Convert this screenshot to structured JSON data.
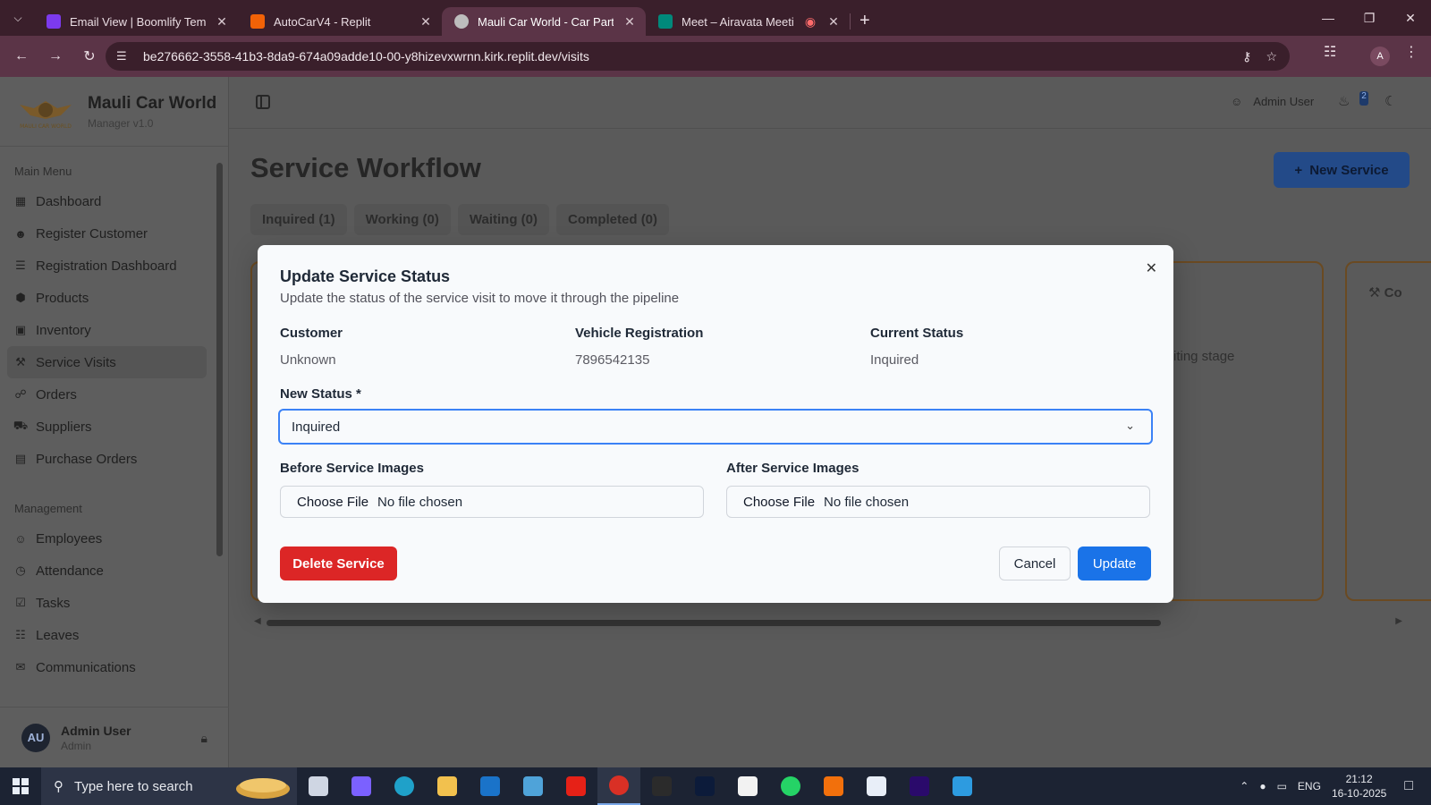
{
  "browser": {
    "tabs": [
      {
        "title": "Email View | Boomlify Temporary",
        "color": "#7c3aed"
      },
      {
        "title": "AutoCarV4 - Replit",
        "color": "#f26207"
      },
      {
        "title": "Mauli Car World - Car Parts & Se",
        "color": "#bdbdbd"
      },
      {
        "title": "Meet – Airavata Meeting",
        "color": "#00897b"
      }
    ],
    "url": "be276662-3558-41b3-8da9-674a09adde10-00-y8hizevxwrnn.kirk.replit.dev/visits",
    "profile_initial": "A"
  },
  "app": {
    "brand_name": "Mauli Car World",
    "brand_version": "Manager v1.0",
    "logo_text": "MAULI CAR WORLD",
    "sections": [
      {
        "title": "Main Menu",
        "items": [
          {
            "label": "Dashboard",
            "icon": "grid-icon"
          },
          {
            "label": "Register Customer",
            "icon": "user-plus-icon"
          },
          {
            "label": "Registration Dashboard",
            "icon": "list-icon"
          },
          {
            "label": "Products",
            "icon": "box-icon"
          },
          {
            "label": "Inventory",
            "icon": "layers-icon"
          },
          {
            "label": "Service Visits",
            "icon": "wrench-icon"
          },
          {
            "label": "Orders",
            "icon": "cart-icon"
          },
          {
            "label": "Suppliers",
            "icon": "truck-icon"
          },
          {
            "label": "Purchase Orders",
            "icon": "file-icon"
          }
        ]
      },
      {
        "title": "Management",
        "items": [
          {
            "label": "Employees",
            "icon": "users-icon"
          },
          {
            "label": "Attendance",
            "icon": "clock-icon"
          },
          {
            "label": "Tasks",
            "icon": "check-square-icon"
          },
          {
            "label": "Leaves",
            "icon": "calendar-icon"
          },
          {
            "label": "Communications",
            "icon": "message-icon"
          }
        ]
      }
    ],
    "user": {
      "initials": "AU",
      "name": "Admin User",
      "role": "Admin"
    },
    "header_user": "Admin User",
    "notification_count": "2",
    "page_title": "Service Workflow",
    "new_service_label": "New Service",
    "workflow_tabs": [
      "Inquired (1)",
      "Working (0)",
      "Waiting (0)",
      "Completed (0)"
    ],
    "background_text": "iting stage",
    "background_col_label": "Co"
  },
  "modal": {
    "title": "Update Service Status",
    "description": "Update the status of the service visit to move it through the pipeline",
    "customer_label": "Customer",
    "customer_value": "Unknown",
    "vehicle_label": "Vehicle Registration",
    "vehicle_value": "7896542135",
    "status_label": "Current Status",
    "status_value": "Inquired",
    "new_status_label": "New Status *",
    "new_status_value": "Inquired",
    "before_label": "Before Service Images",
    "after_label": "After Service Images",
    "choose_file": "Choose File",
    "no_file": "No file chosen",
    "delete_label": "Delete Service",
    "cancel_label": "Cancel",
    "update_label": "Update"
  },
  "taskbar": {
    "search_placeholder": "Type here to search",
    "language": "ENG",
    "time": "21:12",
    "date": "16-10-2025",
    "apps": [
      {
        "name": "task-view-icon",
        "color": "#cfd6e3"
      },
      {
        "name": "copilot-icon",
        "color": "#7b61ff"
      },
      {
        "name": "edge-icon",
        "color": "#1fa1c9"
      },
      {
        "name": "file-explorer-icon",
        "color": "#f2c14e"
      },
      {
        "name": "outlook-icon",
        "color": "#1a73c9"
      },
      {
        "name": "control-panel-icon",
        "color": "#4fa3d9"
      },
      {
        "name": "youtube-icon",
        "color": "#e62117"
      },
      {
        "name": "chrome-icon",
        "color": "#d93025"
      },
      {
        "name": "sony-liv-icon",
        "color": "#2b2b2b"
      },
      {
        "name": "hotstar-icon",
        "color": "#0c1b3a"
      },
      {
        "name": "capcut-icon",
        "color": "#f2f2f2"
      },
      {
        "name": "whatsapp-icon",
        "color": "#25d366"
      },
      {
        "name": "microphone-icon",
        "color": "#f2700c"
      },
      {
        "name": "solitaire-icon",
        "color": "#e8eef8"
      },
      {
        "name": "premiere-pro-icon",
        "color": "#2a0a6b"
      },
      {
        "name": "screen-share-icon",
        "color": "#2d9be0"
      }
    ]
  }
}
